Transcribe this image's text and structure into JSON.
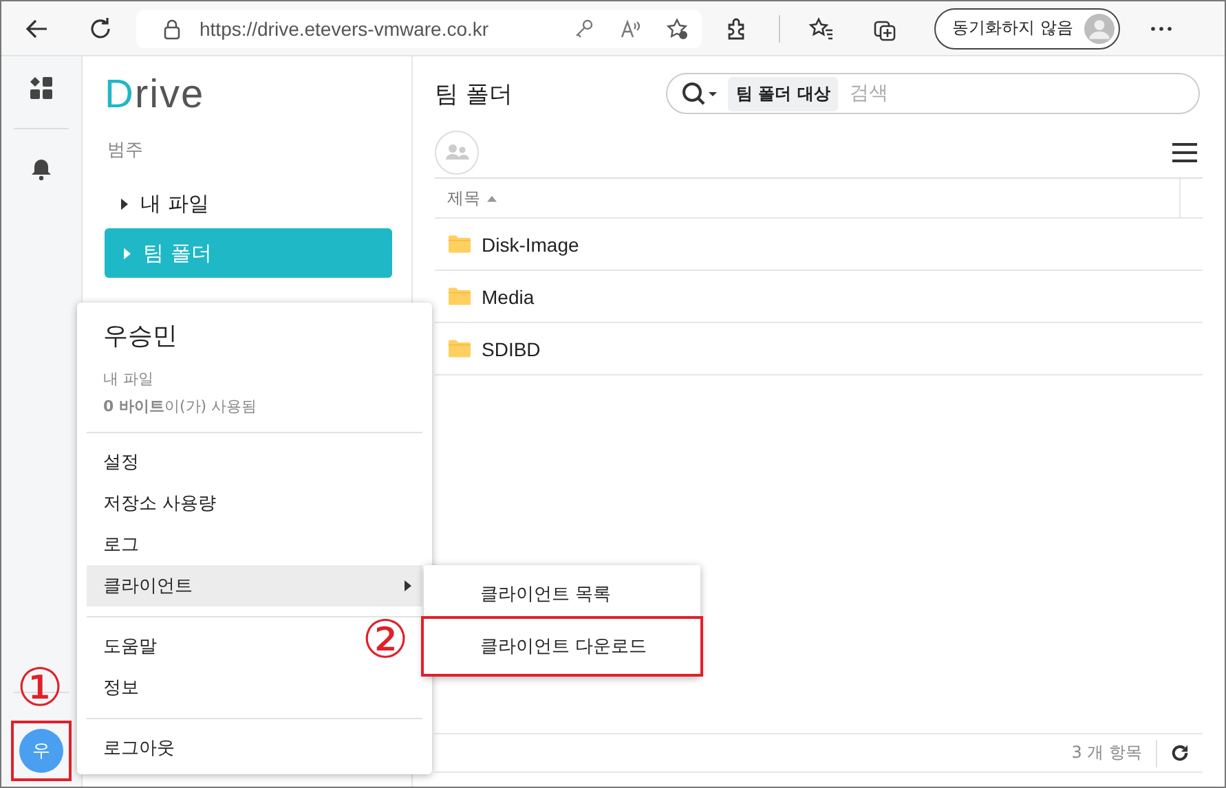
{
  "browser": {
    "url": "https://drive.etevers-vmware.co.kr",
    "profile_button": "동기화하지 않음"
  },
  "logo": {
    "initial": "D",
    "rest": "rive"
  },
  "nav": {
    "heading": "범주",
    "items": [
      {
        "label": "내 파일",
        "selected": false,
        "expandable": true
      },
      {
        "label": "팀 폴더",
        "selected": true,
        "expandable": true
      }
    ]
  },
  "main": {
    "title": "팀 폴더",
    "search": {
      "scope": "팀 폴더 대상",
      "placeholder": "검색"
    },
    "table": {
      "columns": [
        {
          "label": "제목",
          "sort_ascending": true
        }
      ],
      "rows": [
        {
          "name": "Disk-Image"
        },
        {
          "name": "Media"
        },
        {
          "name": "SDIBD"
        }
      ]
    },
    "footer": {
      "count": "3 개 항목"
    }
  },
  "avatar": {
    "initial": "우",
    "outlined": true
  },
  "user_menu": {
    "name": "우승민",
    "subtitle": "내 파일",
    "usage": "**0 바이트**이(가) 사용됨",
    "groups": [
      [
        {
          "label": "설정",
          "highlighted": false,
          "submenu": false
        },
        {
          "label": "저장소 사용량",
          "highlighted": false,
          "submenu": false
        },
        {
          "label": "로그",
          "highlighted": false,
          "submenu": false
        },
        {
          "label": "클라이언트",
          "highlighted": true,
          "submenu": true
        }
      ],
      [
        {
          "label": "도움말",
          "highlighted": false,
          "submenu": false
        },
        {
          "label": "정보",
          "highlighted": false,
          "submenu": false
        }
      ],
      [
        {
          "label": "로그아웃",
          "highlighted": false,
          "submenu": false
        }
      ]
    ]
  },
  "submenu": {
    "items": [
      {
        "label": "클라이언트 목록",
        "outlined": false
      },
      {
        "label": "클라이언트 다운로드",
        "outlined": true
      }
    ]
  },
  "annotations": [
    {
      "label": "①"
    },
    {
      "label": "②"
    }
  ]
}
